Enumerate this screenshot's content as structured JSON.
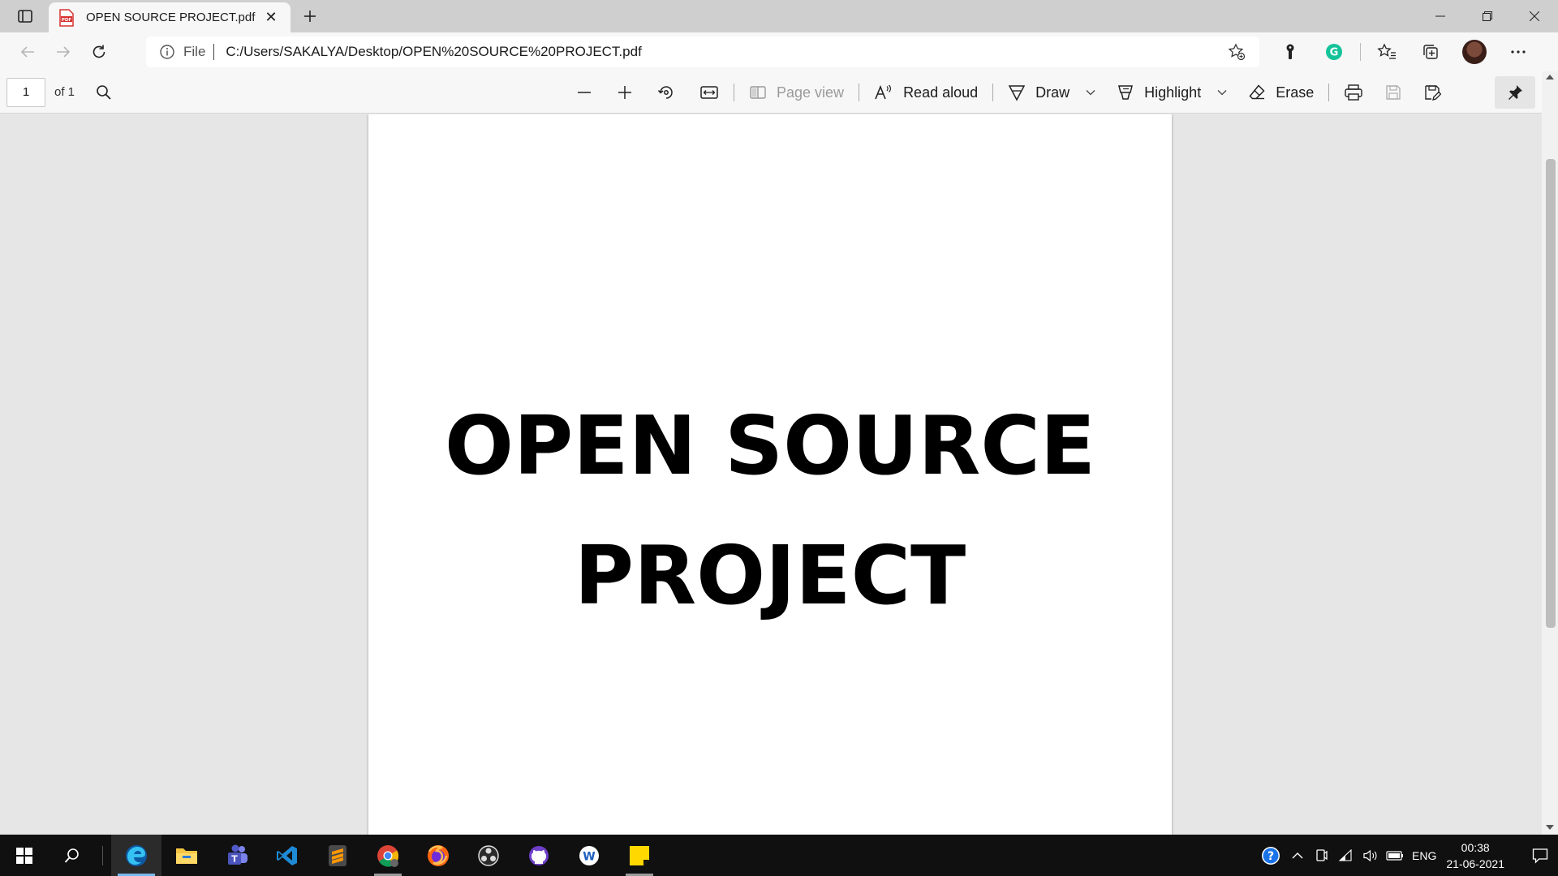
{
  "browser": {
    "tab_title": "OPEN SOURCE PROJECT.pdf",
    "tab_close": "✕",
    "url_scheme": "File",
    "url": "C:/Users/SAKALYA/Desktop/OPEN%20SOURCE%20PROJECT.pdf"
  },
  "pdf_toolbar": {
    "page_number": "1",
    "page_of": "of 1",
    "page_view_label": "Page view",
    "read_aloud_label": "Read aloud",
    "draw_label": "Draw",
    "highlight_label": "Highlight",
    "erase_label": "Erase"
  },
  "document": {
    "line1": "OPEN SOURCE",
    "line2": "PROJECT"
  },
  "taskbar": {
    "language": "ENG",
    "time": "00:38",
    "date": "21-06-2021"
  },
  "colors": {
    "accent_edge": "#0c59a4",
    "grammarly": "#15c39a",
    "pdf_red": "#d6322f"
  }
}
